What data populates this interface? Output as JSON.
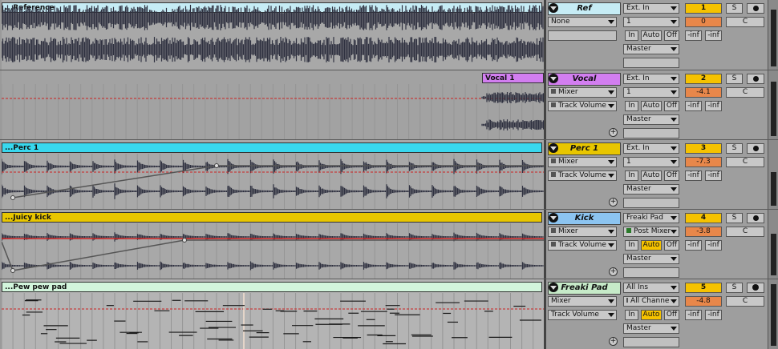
{
  "colors": {
    "reference": "#c6ecf5",
    "vocal": "#d27ef0",
    "perc": "#38d8ee",
    "kick": "#e8c600",
    "pad": "#d2f5dc",
    "accent": "#f5c200",
    "volume": "#e8874a",
    "waveform": "#2f3140",
    "automation": "#cc2222"
  },
  "tracks": [
    {
      "clip_name": "...Reference",
      "title": "Ref",
      "title_color": "#c6ecf5",
      "device_1": "None",
      "device_2": "",
      "input_type": "Ext. In",
      "input_channel": "1",
      "monitor": [
        "In",
        "Auto",
        "Off"
      ],
      "monitor_active": "",
      "output": "Master",
      "number": "1",
      "volume": "0",
      "pan": "C",
      "solo": "S",
      "send_a": "-inf",
      "send_b": "-inf"
    },
    {
      "clip_name": "Vocal 1",
      "title": "Vocal",
      "title_color": "#d27ef0",
      "device_1": "Mixer",
      "device_2": "Track Volume",
      "input_type": "Ext. In",
      "input_channel": "1",
      "monitor": [
        "In",
        "Auto",
        "Off"
      ],
      "monitor_active": "",
      "output": "Master",
      "number": "2",
      "volume": "-4.1",
      "pan": "C",
      "solo": "S",
      "send_a": "-inf",
      "send_b": "-inf"
    },
    {
      "clip_name": "...Perc 1",
      "title": "Perc 1",
      "title_color": "#e8c600",
      "device_1": "Mixer",
      "device_2": "Track Volume",
      "input_type": "Ext. In",
      "input_channel": "1",
      "monitor": [
        "In",
        "Auto",
        "Off"
      ],
      "monitor_active": "",
      "output": "Master",
      "number": "3",
      "volume": "-7.3",
      "pan": "C",
      "solo": "S",
      "send_a": "-inf",
      "send_b": "-inf"
    },
    {
      "clip_name": "...Juicy kick",
      "title": "Kick",
      "title_color": "#8cc4f0",
      "device_1": "Mixer",
      "device_2": "Track Volume",
      "input_type": "Freaki Pad",
      "input_channel": "Post Mixer",
      "monitor": [
        "In",
        "Auto",
        "Off"
      ],
      "monitor_active": "Auto",
      "output": "Master",
      "number": "4",
      "volume": "-3.8",
      "pan": "C",
      "solo": "S",
      "send_a": "-inf",
      "send_b": "-inf"
    },
    {
      "clip_name": "...Pew pew pad",
      "title": "Freaki Pad",
      "title_color": "#c6eac8",
      "device_1": "Mixer",
      "device_2": "Track Volume",
      "input_type": "All Ins",
      "input_channel": "All Channe",
      "monitor": [
        "In",
        "Auto",
        "Off"
      ],
      "monitor_active": "Auto",
      "output": "Master",
      "number": "5",
      "volume": "-4.8",
      "pan": "C",
      "solo": "S",
      "send_a": "-inf",
      "send_b": "-inf"
    }
  ]
}
